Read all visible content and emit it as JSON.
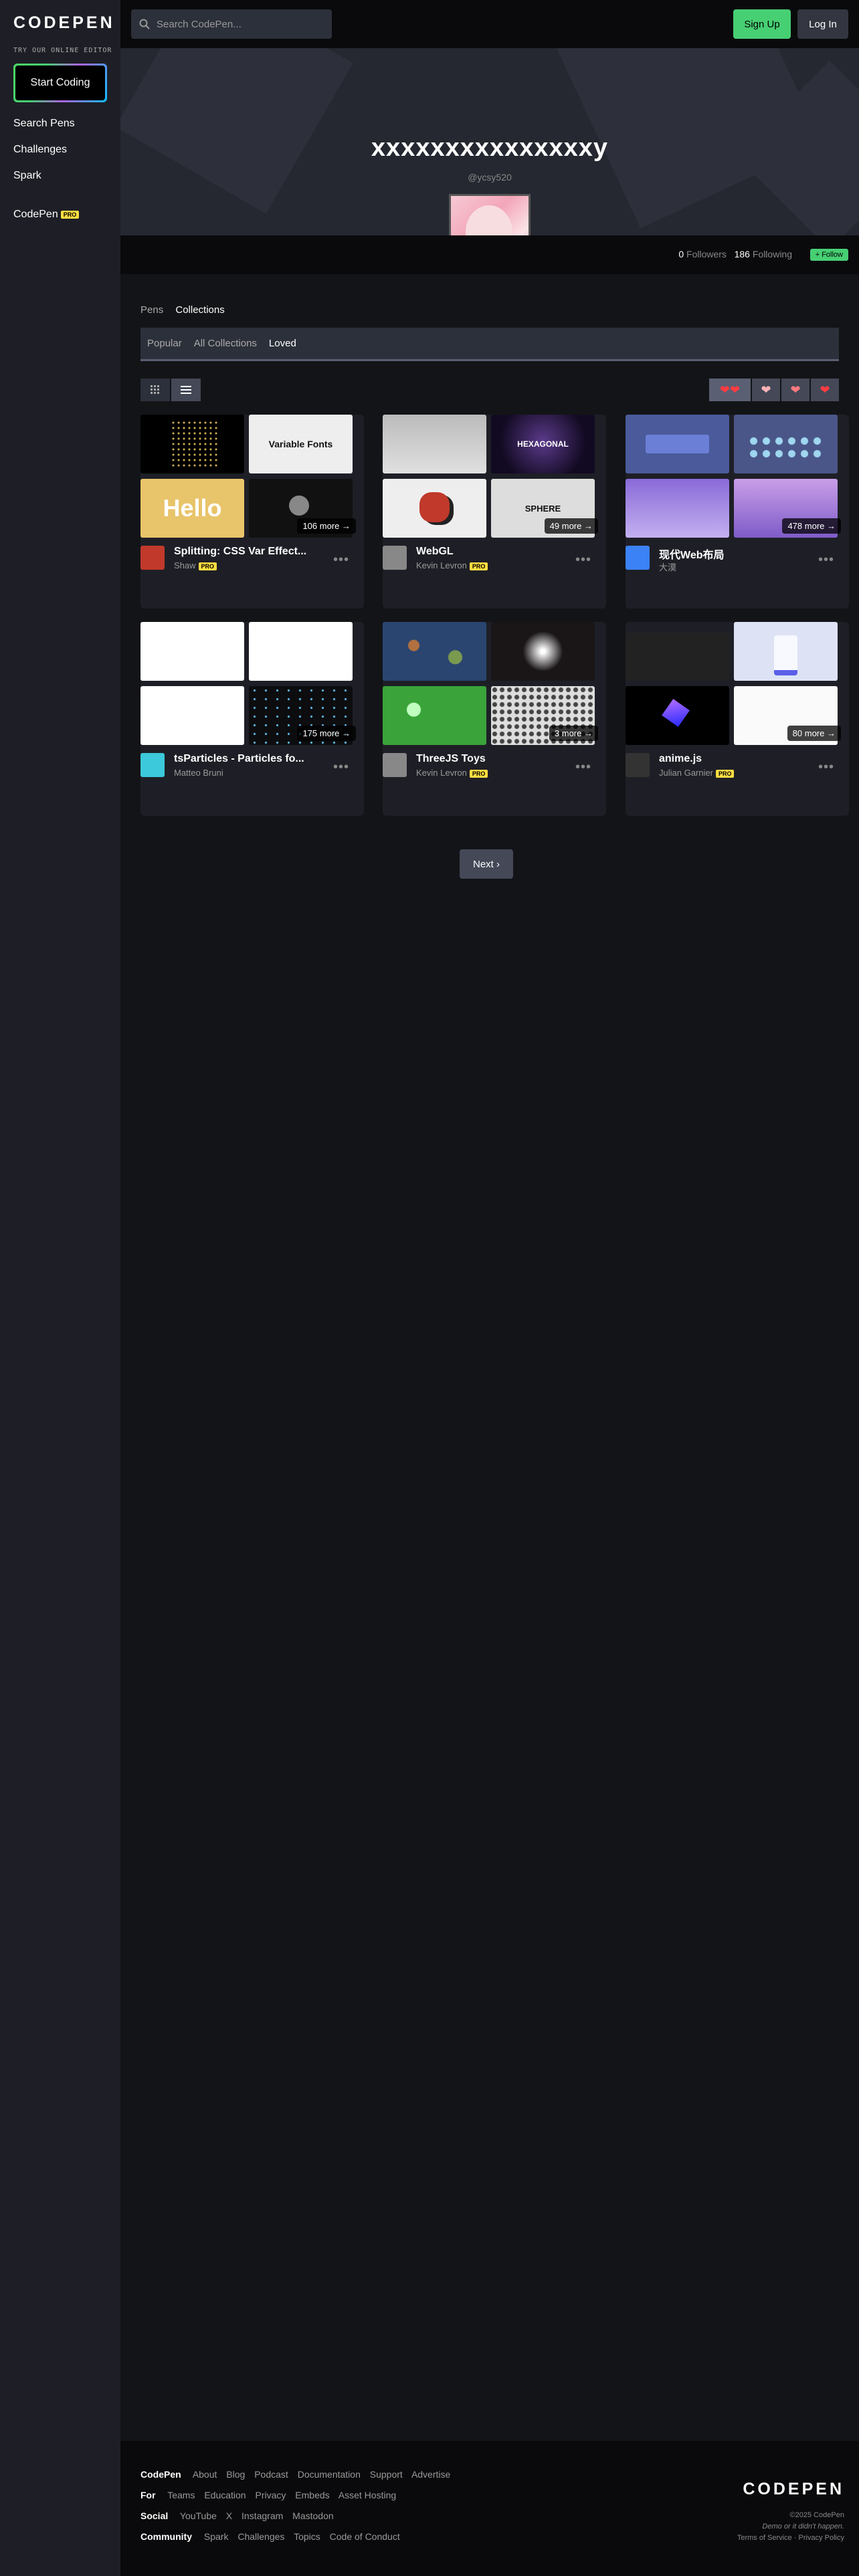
{
  "brand": {
    "logo": "CODEPEN",
    "tagline": "TRY OUR ONLINE EDITOR"
  },
  "sidebar": {
    "start_coding": "Start Coding",
    "items": [
      {
        "label": "Search Pens"
      },
      {
        "label": "Challenges"
      },
      {
        "label": "Spark"
      }
    ],
    "codepen_pro": {
      "label": "CodePen",
      "badge": "PRO"
    }
  },
  "topbar": {
    "search_placeholder": "Search CodePen...",
    "signup": "Sign Up",
    "login": "Log In"
  },
  "profile": {
    "name": "xxxxxxxxxxxxxxxy",
    "handle": "@ycsy520",
    "followers_count": "0",
    "followers_label": "Followers",
    "following_count": "186",
    "following_label": "Following",
    "follow": "+ Follow"
  },
  "tabs": [
    "Pens",
    "Collections"
  ],
  "subtabs": [
    "Popular",
    "All Collections",
    "Loved"
  ],
  "cards": [
    {
      "title": "Splitting: CSS Var Effect...",
      "author": "Shaw",
      "pro": "PRO",
      "more": "106 more",
      "avatar_color": "#c0392b",
      "thumb_text": [
        "",
        "Variable Fonts",
        "Hello",
        ""
      ]
    },
    {
      "title": "WebGL",
      "author": "Kevin Levron",
      "pro": "PRO",
      "more": "49 more",
      "avatar_color": "#888888",
      "thumb_text": [
        "",
        "HEXAGONAL",
        "",
        "SPHERE"
      ]
    },
    {
      "title": "现代Web布局",
      "author": "大漠",
      "pro": "",
      "more": "478 more",
      "avatar_color": "#3b82f6",
      "thumb_text": [
        "",
        "",
        "",
        ""
      ]
    },
    {
      "title": "tsParticles - Particles fo...",
      "author": "Matteo Bruni",
      "pro": "",
      "more": "175 more",
      "avatar_color": "#3bc9db",
      "thumb_text": [
        "",
        "",
        "",
        ""
      ]
    },
    {
      "title": "ThreeJS Toys",
      "author": "Kevin Levron",
      "pro": "PRO",
      "more": "3 more",
      "avatar_color": "#888888",
      "thumb_text": [
        "",
        "",
        "",
        ""
      ]
    },
    {
      "title": "anime.js",
      "author": "Julian Garnier",
      "pro": "PRO",
      "more": "80 more",
      "avatar_color": "#333333",
      "thumb_text": [
        "",
        "",
        "",
        ""
      ]
    }
  ],
  "pagination": {
    "next": "Next"
  },
  "footer": {
    "rows": [
      {
        "heading": "CodePen",
        "links": [
          "About",
          "Blog",
          "Podcast",
          "Documentation",
          "Support",
          "Advertise"
        ]
      },
      {
        "heading": "For",
        "links": [
          "Teams",
          "Education",
          "Privacy",
          "Embeds",
          "Asset Hosting"
        ]
      },
      {
        "heading": "Social",
        "links": [
          "YouTube",
          "X",
          "Instagram",
          "Mastodon"
        ]
      },
      {
        "heading": "Community",
        "links": [
          "Spark",
          "Challenges",
          "Topics",
          "Code of Conduct"
        ]
      }
    ],
    "copyright": "©2025 CodePen",
    "demo_line": "Demo or it didn't happen.",
    "legal": "Terms of Service · Privacy Policy"
  }
}
